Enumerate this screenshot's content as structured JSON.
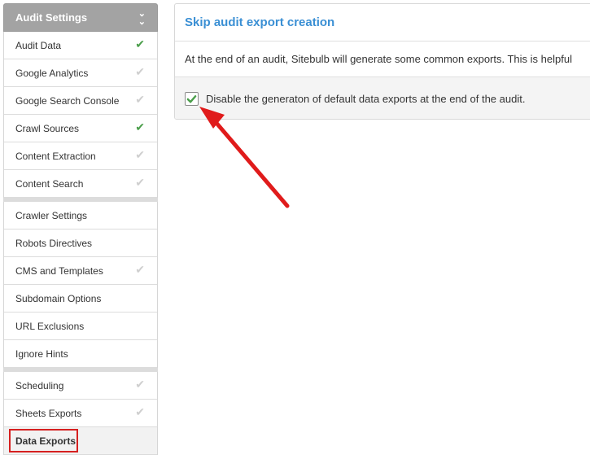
{
  "sidebar": {
    "header": "Audit Settings",
    "group1": [
      {
        "label": "Audit Data",
        "check": "green"
      },
      {
        "label": "Google Analytics",
        "check": "gray"
      },
      {
        "label": "Google Search Console",
        "check": "gray"
      },
      {
        "label": "Crawl Sources",
        "check": "green"
      },
      {
        "label": "Content Extraction",
        "check": "gray"
      },
      {
        "label": "Content Search",
        "check": "gray"
      }
    ],
    "group2": [
      {
        "label": "Crawler Settings",
        "check": "none"
      },
      {
        "label": "Robots Directives",
        "check": "none"
      },
      {
        "label": "CMS and Templates",
        "check": "gray"
      },
      {
        "label": "Subdomain Options",
        "check": "none"
      },
      {
        "label": "URL Exclusions",
        "check": "none"
      },
      {
        "label": "Ignore Hints",
        "check": "none"
      }
    ],
    "group3": [
      {
        "label": "Scheduling",
        "check": "gray"
      },
      {
        "label": "Sheets Exports",
        "check": "gray"
      },
      {
        "label": "Data Exports",
        "check": "none",
        "active": true
      }
    ]
  },
  "panel": {
    "title": "Skip audit export creation",
    "description": "At the end of an audit, Sitebulb will generate some common exports. This is helpful",
    "option_label": "Disable the generaton of default data exports at the end of the audit.",
    "option_checked": true
  },
  "colors": {
    "accent_blue": "#3a8fd4",
    "check_green": "#4a9e4a",
    "highlight_red": "#d62020"
  }
}
